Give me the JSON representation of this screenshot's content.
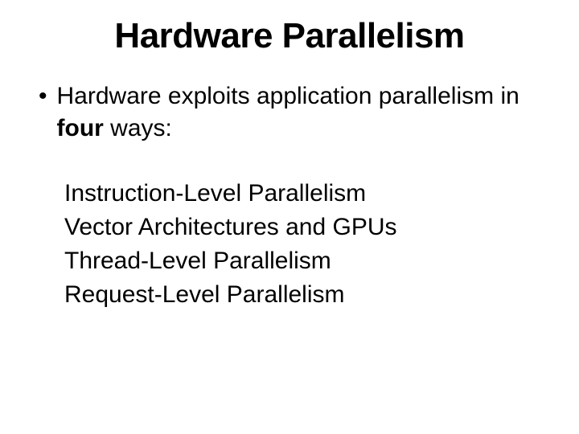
{
  "title": "Hardware Parallelism",
  "intro": {
    "prefix": "Hardware exploits application parallelism in ",
    "bold": "four",
    "suffix": " ways:"
  },
  "items": [
    "Instruction-Level Parallelism",
    "Vector Architectures and GPUs",
    "Thread-Level Parallelism",
    "Request-Level Parallelism"
  ]
}
